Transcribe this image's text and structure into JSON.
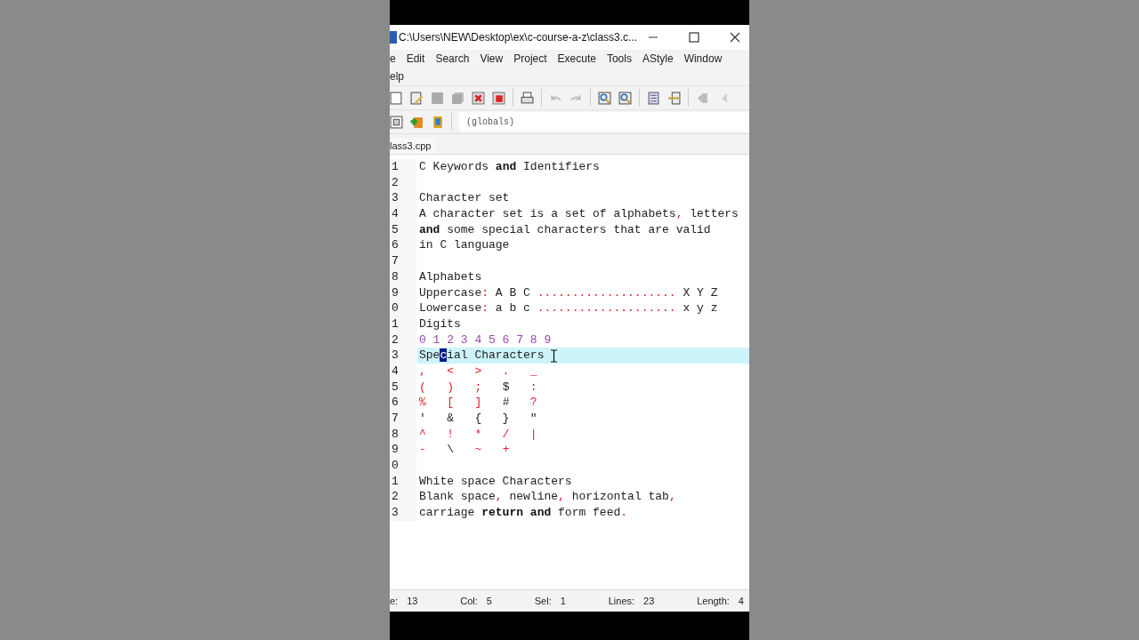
{
  "window": {
    "title": "C:\\Users\\NEW\\Desktop\\ex\\c-course-a-z\\class3.c..."
  },
  "menu": [
    "e",
    "Edit",
    "Search",
    "View",
    "Project",
    "Execute",
    "Tools",
    "AStyle",
    "Window",
    "elp"
  ],
  "scope": {
    "value": "(globals)"
  },
  "tabs": [
    {
      "label": "lass3.cpp",
      "selected": true
    }
  ],
  "lines": [
    {
      "number": "1",
      "current": false,
      "tokens": [
        {
          "text": "C Keywords ",
          "kind": "plain"
        },
        {
          "text": "and",
          "kind": "keyword"
        },
        {
          "text": " Identifiers",
          "kind": "plain"
        }
      ]
    },
    {
      "number": "2",
      "current": false
    },
    {
      "number": "3",
      "current": false,
      "tokens": [
        {
          "text": "Character set",
          "kind": "plain"
        }
      ]
    },
    {
      "number": "4",
      "current": false,
      "tokens": [
        {
          "text": "A character set is a set of alphabets",
          "kind": "plain"
        },
        {
          "text": ",",
          "kind": "operator"
        },
        {
          "text": " letters",
          "kind": "plain"
        }
      ]
    },
    {
      "number": "5",
      "current": false,
      "tokens": [
        {
          "text": "and",
          "kind": "keyword"
        },
        {
          "text": " some special characters that are valid",
          "kind": "plain"
        }
      ]
    },
    {
      "number": "6",
      "current": false,
      "tokens": [
        {
          "text": "in C language",
          "kind": "plain"
        }
      ]
    },
    {
      "number": "7",
      "current": false
    },
    {
      "number": "8",
      "current": false,
      "tokens": [
        {
          "text": "Alphabets",
          "kind": "plain"
        }
      ]
    },
    {
      "number": "9",
      "current": false,
      "tokens": [
        {
          "text": "Uppercase",
          "kind": "plain"
        },
        {
          "text": ":",
          "kind": "operator"
        },
        {
          "text": " A B C ",
          "kind": "plain"
        },
        {
          "text": "....................",
          "kind": "operator"
        },
        {
          "text": " X Y Z",
          "kind": "plain"
        }
      ]
    },
    {
      "number": "0",
      "current": false,
      "tokens": [
        {
          "text": "Lowercase",
          "kind": "plain"
        },
        {
          "text": ":",
          "kind": "operator"
        },
        {
          "text": " a b c ",
          "kind": "plain"
        },
        {
          "text": "....................",
          "kind": "operator"
        },
        {
          "text": " x y z",
          "kind": "plain"
        }
      ]
    },
    {
      "number": "1",
      "current": false,
      "tokens": [
        {
          "text": "Digits",
          "kind": "plain"
        }
      ]
    },
    {
      "number": "2",
      "current": false,
      "tokens": [
        {
          "text": "0 1 2 3 4 5 6 7 8 9",
          "kind": "number"
        }
      ]
    },
    {
      "number": "3",
      "current": true,
      "tokens": [
        {
          "text": "Spe",
          "kind": "plain"
        },
        {
          "text": "c",
          "kind": "selection"
        },
        {
          "text": "ial Characters",
          "kind": "plain"
        }
      ]
    },
    {
      "number": "4",
      "current": false,
      "tokens": [
        {
          "text": ",   <   >   .   _",
          "kind": "operator"
        }
      ]
    },
    {
      "number": "5",
      "current": false,
      "tokens": [
        {
          "text": "(   )   ;   ",
          "kind": "operator"
        },
        {
          "text": "$",
          "kind": "plain"
        },
        {
          "text": "   :",
          "kind": "operator"
        }
      ]
    },
    {
      "number": "6",
      "current": false,
      "tokens": [
        {
          "text": "%   [   ]   ",
          "kind": "operator"
        },
        {
          "text": "#",
          "kind": "plain"
        },
        {
          "text": "   ?",
          "kind": "operator"
        }
      ]
    },
    {
      "number": "7",
      "current": false,
      "tokens": [
        {
          "text": "'   &   {   }   \"",
          "kind": "plain"
        }
      ]
    },
    {
      "number": "8",
      "current": false,
      "tokens": [
        {
          "text": "^   !   *   /   |",
          "kind": "operator"
        }
      ]
    },
    {
      "number": "9",
      "current": false,
      "tokens": [
        {
          "text": "-",
          "kind": "operator"
        },
        {
          "text": "   \\   ",
          "kind": "plain"
        },
        {
          "text": "~   +",
          "kind": "operator"
        }
      ]
    },
    {
      "number": "0",
      "current": false
    },
    {
      "number": "1",
      "current": false,
      "tokens": [
        {
          "text": "White space Characters",
          "kind": "plain"
        }
      ]
    },
    {
      "number": "2",
      "current": false,
      "tokens": [
        {
          "text": "Blank space",
          "kind": "plain"
        },
        {
          "text": ",",
          "kind": "operator"
        },
        {
          "text": " newline",
          "kind": "plain"
        },
        {
          "text": ",",
          "kind": "operator"
        },
        {
          "text": " horizontal tab",
          "kind": "plain"
        },
        {
          "text": ",",
          "kind": "operator"
        }
      ]
    },
    {
      "number": "3",
      "current": false,
      "tokens": [
        {
          "text": "carriage ",
          "kind": "plain"
        },
        {
          "text": "return and",
          "kind": "keyword"
        },
        {
          "text": " form feed",
          "kind": "plain"
        },
        {
          "text": ".",
          "kind": "operator"
        }
      ]
    }
  ],
  "status_bar": [
    {
      "label": "e:",
      "value": "13"
    },
    {
      "label": "Col:",
      "value": "5"
    },
    {
      "label": "Sel:",
      "value": "1"
    },
    {
      "label": "Lines:",
      "value": "23"
    },
    {
      "label": "Length:",
      "value": "4"
    }
  ]
}
